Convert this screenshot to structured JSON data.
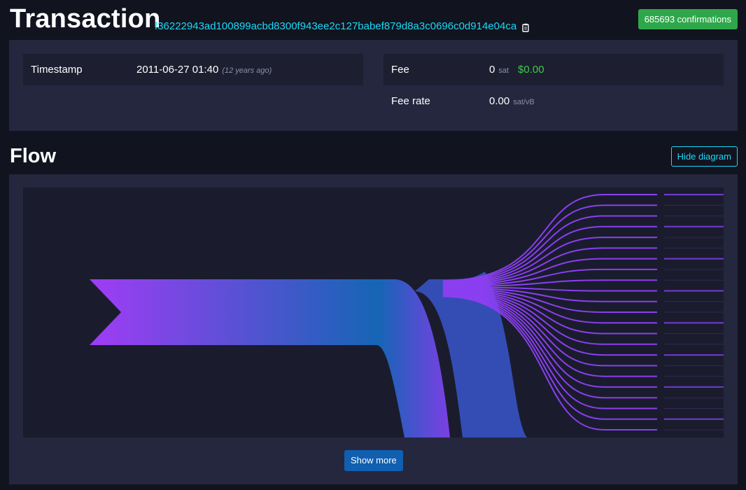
{
  "header": {
    "title": "Transaction",
    "txid": "f36222943ad100899acbd8300f943ee2c127babef879d8a3c0696c0d914e04ca",
    "confirmations": "685693 confirmations"
  },
  "details": {
    "timestamp_label": "Timestamp",
    "timestamp_value": "2011-06-27 01:40",
    "timestamp_relative": "(12 years ago)",
    "fee_label": "Fee",
    "fee_value": "0",
    "fee_unit": "sat",
    "fee_fiat": "$0.00",
    "fee_rate_label": "Fee rate",
    "fee_rate_value": "0.00",
    "fee_rate_unit": "sat/vB"
  },
  "flow": {
    "title": "Flow",
    "hide_label": "Hide diagram",
    "show_more_label": "Show more",
    "colors": {
      "input": "#a03cf5",
      "middle": "#1366b4",
      "output": "#7b3fe4"
    },
    "visible_outputs": 23
  }
}
